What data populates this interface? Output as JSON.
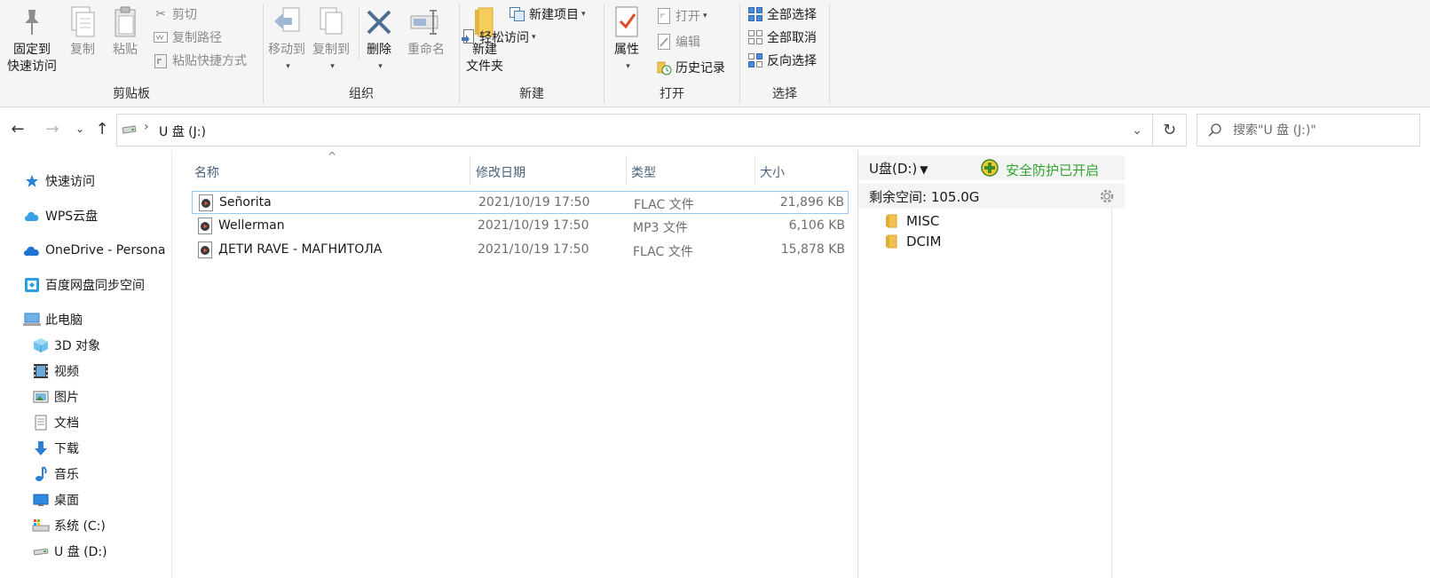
{
  "ribbon": {
    "clipboard": {
      "group_label": "剪贴板",
      "pin_line1": "固定到",
      "pin_line2": "快速访问",
      "copy": "复制",
      "paste": "粘贴",
      "cut": "剪切",
      "copy_path": "复制路径",
      "paste_shortcut": "粘贴快捷方式"
    },
    "organize": {
      "group_label": "组织",
      "move_to": "移动到",
      "copy_to": "复制到",
      "delete": "删除",
      "rename": "重命名"
    },
    "new": {
      "group_label": "新建",
      "new_folder_line1": "新建",
      "new_folder_line2": "文件夹",
      "new_item": "新建项目",
      "easy_access": "轻松访问"
    },
    "open": {
      "group_label": "打开",
      "properties": "属性",
      "open": "打开",
      "edit": "编辑",
      "history": "历史记录"
    },
    "select": {
      "group_label": "选择",
      "select_all": "全部选择",
      "select_none": "全部取消",
      "invert": "反向选择"
    }
  },
  "address": {
    "breadcrumb_sep": "›",
    "location": "U 盘 (J:)",
    "search_placeholder": "搜索\"U 盘 (J:)\""
  },
  "navpane": {
    "items": [
      {
        "label": "快速访问",
        "icon": "star-icon"
      },
      {
        "label": "WPS云盘",
        "icon": "wps-cloud-icon"
      },
      {
        "label": "OneDrive - Persona",
        "icon": "onedrive-cloud-icon"
      },
      {
        "label": "百度网盘同步空间",
        "icon": "baidu-netdisk-icon"
      },
      {
        "label": "此电脑",
        "icon": "computer-icon"
      },
      {
        "label": "3D 对象",
        "icon": "cube-3d-icon"
      },
      {
        "label": "视频",
        "icon": "film-icon"
      },
      {
        "label": "图片",
        "icon": "picture-icon"
      },
      {
        "label": "文档",
        "icon": "document-icon"
      },
      {
        "label": "下载",
        "icon": "download-arrow-icon"
      },
      {
        "label": "音乐",
        "icon": "music-note-icon"
      },
      {
        "label": "桌面",
        "icon": "desktop-icon"
      },
      {
        "label": "系统 (C:)",
        "icon": "system-drive-icon"
      },
      {
        "label": "U 盘 (D:)",
        "icon": "usb-drive-icon"
      }
    ]
  },
  "filelist": {
    "columns": {
      "name": "名称",
      "date": "修改日期",
      "type": "类型",
      "size": "大小"
    },
    "sort_indicator": "^",
    "rows": [
      {
        "name": "Señorita",
        "date": "2021/10/19 17:50",
        "type": "FLAC 文件",
        "size": "21,896 KB"
      },
      {
        "name": "Wellerman",
        "date": "2021/10/19 17:50",
        "type": "MP3 文件",
        "size": "6,106 KB"
      },
      {
        "name": "ДЕТИ RAVE - МАГНИТОЛА",
        "date": "2021/10/19 17:50",
        "type": "FLAC 文件",
        "size": "15,878 KB"
      }
    ]
  },
  "sidepanel": {
    "drive_label": "U盘(D:)",
    "safe_status": "安全防护已开启",
    "free_space": "剩余空间: 105.0G",
    "folders": [
      "MISC",
      "DCIM"
    ]
  },
  "colors": {
    "ribbon_bg": "#f5f5f5",
    "accent_blue": "#1e73d1",
    "safe_green": "#2fa52f",
    "selection_border": "#99c9ef",
    "folder_yellow": "#f2c24f"
  }
}
